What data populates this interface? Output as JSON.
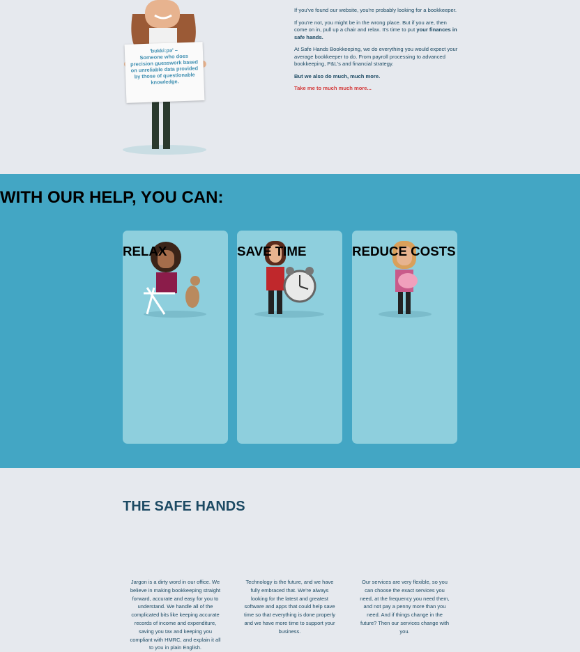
{
  "sign": {
    "pron": "'bʊkkiːpə' –",
    "text": "Someone who does precision guesswork based on unreliable data provided by those of questionable knowledge."
  },
  "intro": {
    "p1": "If you've found our website, you're probably looking for a bookkeeper.",
    "p2a": "If you're not, you might be in the wrong place. But if you are, then come on in, pull up a chair and relax. It's time to put ",
    "p2b": "your finances in safe hands.",
    "p3": "At Safe Hands Bookkeeping, we do everything you would expect your average bookkeeper to do. From payroll processing to advanced bookkeeping, P&L's and financial strategy.",
    "p4": "But we also do much, much more.",
    "link": "Take me to much much more..."
  },
  "help": {
    "title": "WITH OUR HELP, YOU CAN:",
    "cards": [
      {
        "title": "RELAX",
        "text": "Jargon is a dirty word in our office. We believe in making bookkeeping straight forward, accurate and easy for you to understand. We handle all of the complicated bits like keeping accurate records of income and expenditure, saving you tax and keeping you compliant with HMRC, and explain it all to you in plain English."
      },
      {
        "title": "SAVE TIME",
        "text": "Technology is the future, and we have fully embraced that. We're always looking for the latest and greatest software and apps that could help save time so that everything is done properly and we have more time to support your business."
      },
      {
        "title": "REDUCE COSTS",
        "text": "Our services are very flexible, so you can choose the exact services you need, at the frequency you need them, and not pay a penny more than you need. And if things change in the future? Then our services change with you."
      }
    ]
  },
  "bottom": {
    "title": "THE SAFE HANDS"
  },
  "colors": {
    "band": "#43a6c4",
    "card": "#8ecfdd",
    "heading": "#1c4a63",
    "link": "#d43a3a"
  }
}
